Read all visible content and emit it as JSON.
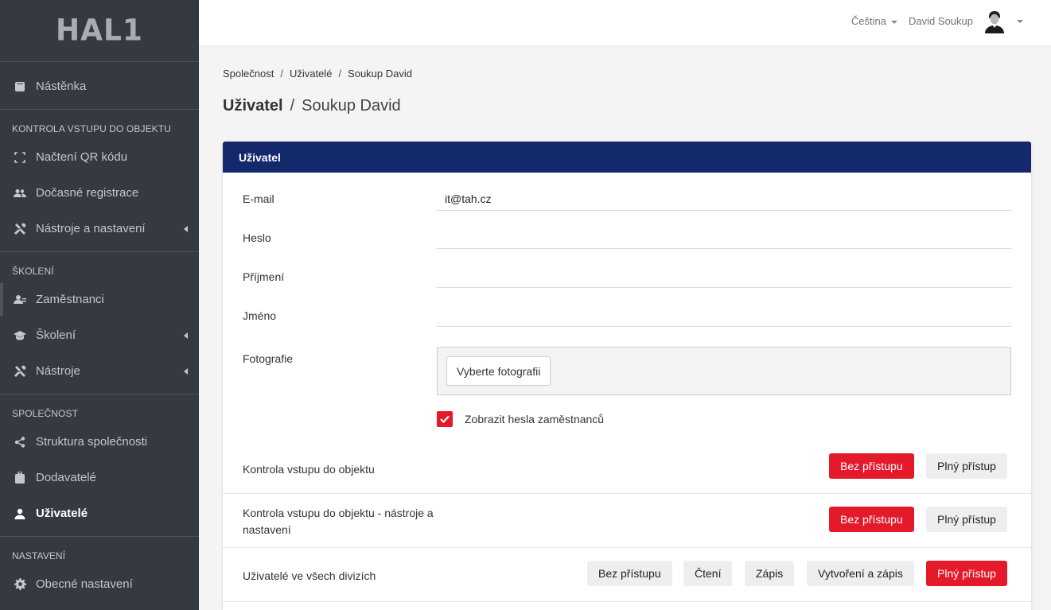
{
  "brand": {
    "logo_text": "HAL1"
  },
  "sidebar": {
    "items": [
      {
        "label": "Nástěnka",
        "icon": "dashboard-icon"
      },
      {
        "header": "KONTROLA VSTUPU DO OBJEKTU"
      },
      {
        "label": "Načtení QR kódu",
        "icon": "qr-scan-icon"
      },
      {
        "label": "Dočasné registrace",
        "icon": "users-icon"
      },
      {
        "label": "Nástroje a nastavení",
        "icon": "tools-icon"
      },
      {
        "header": "ŠKOLENÍ"
      },
      {
        "label": "Zaměstnanci",
        "icon": "employees-icon"
      },
      {
        "label": "Školení",
        "icon": "graduation-cap-icon"
      },
      {
        "label": "Nástroje",
        "icon": "tools-icon"
      },
      {
        "header": "SPOLEČNOST"
      },
      {
        "label": "Struktura společnosti",
        "icon": "share-icon"
      },
      {
        "label": "Dodavatelé",
        "icon": "briefcase-icon"
      },
      {
        "label": "Uživatelé",
        "icon": "user-icon"
      },
      {
        "header": "NASTAVENÍ"
      },
      {
        "label": "Obecné nastavení",
        "icon": "gear-icon"
      }
    ]
  },
  "topbar": {
    "language": "Čeština",
    "user_name": "David Soukup"
  },
  "breadcrumb": [
    "Společnost",
    "Uživatelé",
    "Soukup David"
  ],
  "page_title": {
    "main": "Uživatel",
    "sub": "Soukup David"
  },
  "card": {
    "title": "Uživatel",
    "fields": {
      "email_label": "E-mail",
      "email_value": "it@tah.cz",
      "password_label": "Heslo",
      "surname_label": "Příjmení",
      "firstname_label": "Jméno",
      "photo_label": "Fotografie",
      "photo_button": "Vyberte fotografii",
      "show_passwords_label": "Zobrazit hesla zaměstnanců"
    },
    "permissions": [
      {
        "label": "Kontrola vstupu do objektu",
        "buttons": [
          "Bez přístupu",
          "Plný přístup"
        ],
        "selected": "Bez přístupu"
      },
      {
        "label": "Kontrola vstupu do objektu - nástroje a nastavení",
        "buttons": [
          "Bez přístupu",
          "Plný přístup"
        ],
        "selected": "Bez přístupu"
      },
      {
        "label": "Uživatelé ve všech divizích",
        "buttons": [
          "Bez přístupu",
          "Čtení",
          "Zápis",
          "Vytvoření a zápis",
          "Plný přístup"
        ],
        "selected": "Plný přístup"
      }
    ]
  },
  "colors": {
    "sidebar_bg": "#343a40",
    "card_header": "#13296b",
    "accent_red": "#e4192a"
  }
}
